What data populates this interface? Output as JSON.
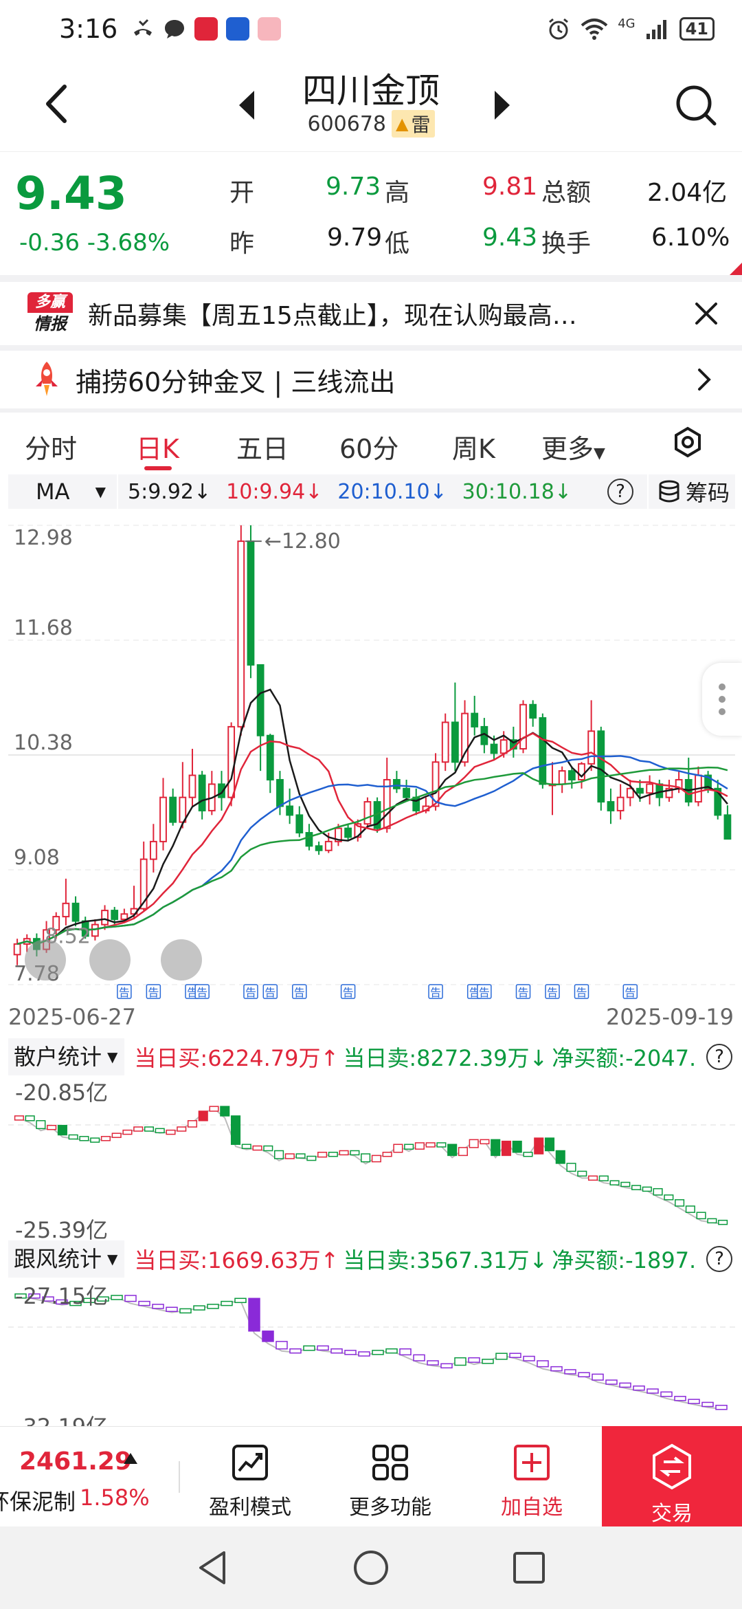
{
  "status_bar": {
    "time": "3:16",
    "battery": "41",
    "network": "4G"
  },
  "header": {
    "title": "四川金顶",
    "code": "600678",
    "risk_tag": "雷"
  },
  "quote": {
    "price": "9.43",
    "change": "-0.36",
    "change_pct": "-3.68%",
    "open_label": "开",
    "open": "9.73",
    "high_label": "高",
    "high": "9.81",
    "amount_label": "总额",
    "amount": "2.04亿",
    "prev_label": "昨",
    "prev": "9.79",
    "low_label": "低",
    "low": "9.43",
    "turnover_label": "换手",
    "turnover": "6.10%"
  },
  "ad": {
    "logo_top": "多赢",
    "logo_bottom": "情报",
    "text": "新品募集【周五15点截止】，现在认购最高…"
  },
  "signal": {
    "text": "捕捞60分钟金叉 | 三线流出"
  },
  "tabs": {
    "items": [
      "分时",
      "日K",
      "五日",
      "60分",
      "周K",
      "更多"
    ],
    "active": "日K"
  },
  "ma": {
    "selector": "MA",
    "ma5": "5:9.92↓",
    "ma10": "10:9.94↓",
    "ma20": "20:10.10↓",
    "ma30": "30:10.18↓",
    "help": "?",
    "chips_label": "筹码"
  },
  "colors": {
    "up": "#e0253a",
    "down": "#0a9a3e",
    "ma5": "#1a1a1a",
    "ma10": "#e0253a",
    "ma20": "#1f5fd0",
    "ma30": "#1e9a3a"
  },
  "chart_data": {
    "type": "candlestick",
    "y_ticks": [
      "12.98",
      "11.68",
      "10.38",
      "9.08",
      "7.78"
    ],
    "ylim": [
      7.78,
      12.98
    ],
    "max_label": "12.80",
    "min_label": "8.52",
    "x_start": "2025-06-27",
    "x_end": "2025-09-19",
    "announce_label": "告",
    "candles": [
      [
        8.12,
        8.24,
        8.0,
        8.3
      ],
      [
        8.24,
        8.3,
        8.15,
        8.35
      ],
      [
        8.3,
        8.18,
        8.1,
        8.36
      ],
      [
        8.18,
        8.4,
        8.14,
        8.5
      ],
      [
        8.4,
        8.55,
        8.3,
        8.6
      ],
      [
        8.55,
        8.7,
        8.45,
        8.98
      ],
      [
        8.7,
        8.5,
        8.44,
        8.78
      ],
      [
        8.5,
        8.33,
        8.3,
        8.55
      ],
      [
        8.33,
        8.46,
        8.28,
        8.52
      ],
      [
        8.46,
        8.62,
        8.4,
        8.68
      ],
      [
        8.62,
        8.52,
        8.46,
        8.66
      ],
      [
        8.52,
        8.58,
        8.48,
        8.64
      ],
      [
        8.58,
        8.64,
        8.52,
        8.9
      ],
      [
        8.64,
        9.2,
        8.62,
        9.4
      ],
      [
        9.2,
        9.4,
        9.05,
        9.6
      ],
      [
        9.4,
        9.9,
        9.3,
        10.12
      ],
      [
        9.9,
        9.62,
        9.58,
        10.0
      ],
      [
        9.62,
        9.9,
        9.55,
        10.3
      ],
      [
        9.9,
        10.15,
        9.8,
        10.45
      ],
      [
        10.15,
        9.75,
        9.65,
        10.2
      ],
      [
        9.75,
        10.05,
        9.7,
        10.2
      ],
      [
        10.05,
        9.9,
        9.75,
        10.2
      ],
      [
        9.9,
        10.7,
        9.8,
        10.75
      ],
      [
        10.7,
        12.8,
        10.6,
        12.98
      ],
      [
        12.8,
        11.4,
        11.25,
        12.98
      ],
      [
        11.4,
        10.6,
        10.2,
        10.9
      ],
      [
        10.6,
        10.1,
        9.95,
        10.62
      ],
      [
        10.1,
        9.8,
        9.7,
        10.2
      ],
      [
        9.8,
        9.7,
        9.6,
        10.0
      ],
      [
        9.7,
        9.5,
        9.45,
        9.8
      ],
      [
        9.5,
        9.35,
        9.3,
        9.6
      ],
      [
        9.35,
        9.3,
        9.25,
        9.4
      ],
      [
        9.3,
        9.4,
        9.27,
        9.5
      ],
      [
        9.4,
        9.55,
        9.35,
        9.6
      ],
      [
        9.55,
        9.45,
        9.42,
        9.6
      ],
      [
        9.45,
        9.6,
        9.4,
        9.65
      ],
      [
        9.6,
        9.85,
        9.55,
        9.9
      ],
      [
        9.85,
        9.55,
        9.5,
        9.9
      ],
      [
        9.55,
        10.1,
        9.5,
        10.35
      ],
      [
        10.1,
        10.0,
        9.95,
        10.2
      ],
      [
        10.0,
        9.9,
        9.85,
        10.1
      ],
      [
        9.9,
        9.75,
        9.7,
        10.0
      ],
      [
        9.75,
        9.8,
        9.72,
        9.9
      ],
      [
        9.8,
        10.3,
        9.75,
        10.4
      ],
      [
        10.3,
        10.75,
        10.2,
        10.85
      ],
      [
        10.75,
        10.3,
        10.2,
        11.2
      ],
      [
        10.3,
        10.85,
        10.25,
        11.0
      ],
      [
        10.85,
        10.7,
        10.6,
        11.05
      ],
      [
        10.7,
        10.5,
        10.4,
        10.8
      ],
      [
        10.5,
        10.4,
        10.32,
        10.6
      ],
      [
        10.4,
        10.55,
        10.35,
        10.65
      ],
      [
        10.55,
        10.45,
        10.35,
        10.7
      ],
      [
        10.45,
        10.95,
        10.4,
        11.0
      ],
      [
        10.95,
        10.8,
        10.7,
        11.0
      ],
      [
        10.8,
        10.05,
        10.0,
        10.85
      ],
      [
        10.05,
        10.05,
        9.7,
        10.3
      ],
      [
        10.05,
        10.2,
        9.95,
        10.25
      ],
      [
        10.2,
        10.1,
        10.0,
        10.25
      ],
      [
        10.1,
        10.28,
        10.0,
        10.3
      ],
      [
        10.28,
        10.65,
        10.2,
        11.0
      ],
      [
        10.65,
        9.85,
        9.75,
        10.7
      ],
      [
        9.85,
        9.75,
        9.6,
        10.0
      ],
      [
        9.75,
        9.9,
        9.65,
        10.05
      ],
      [
        9.9,
        10.0,
        9.8,
        10.1
      ],
      [
        10.0,
        9.95,
        9.85,
        10.1
      ],
      [
        9.95,
        10.05,
        9.82,
        10.15
      ],
      [
        10.05,
        9.9,
        9.8,
        10.1
      ],
      [
        9.9,
        10.0,
        9.85,
        10.1
      ],
      [
        10.0,
        10.1,
        9.95,
        10.2
      ],
      [
        10.1,
        9.85,
        9.8,
        10.35
      ],
      [
        9.85,
        10.15,
        9.8,
        10.25
      ],
      [
        10.15,
        10.0,
        9.95,
        10.2
      ],
      [
        10.0,
        9.7,
        9.65,
        10.1
      ],
      [
        9.7,
        9.43,
        9.43,
        9.81
      ]
    ]
  },
  "retail": {
    "selector": "散户统计",
    "buy": "当日买:6224.79万↑",
    "sell": "当日卖:8272.39万↓",
    "net": "净买额:-2047.",
    "top": "-20.85亿",
    "bottom": "-25.39亿",
    "help": "?"
  },
  "follow": {
    "selector": "跟风统计",
    "buy": "当日买:1669.63万↑",
    "sell": "当日卖:3567.31万↓",
    "net": "净买额:-1897.",
    "top": "-27.15亿",
    "bottom": "-32.19亿",
    "help": "?"
  },
  "bottom_bar": {
    "index_value": "2461.29",
    "index_name": "环保泥制",
    "index_pct": "1.58%",
    "profit_label": "盈利模式",
    "more_label": "更多功能",
    "watch_label": "加自选",
    "trade_label": "交易"
  }
}
